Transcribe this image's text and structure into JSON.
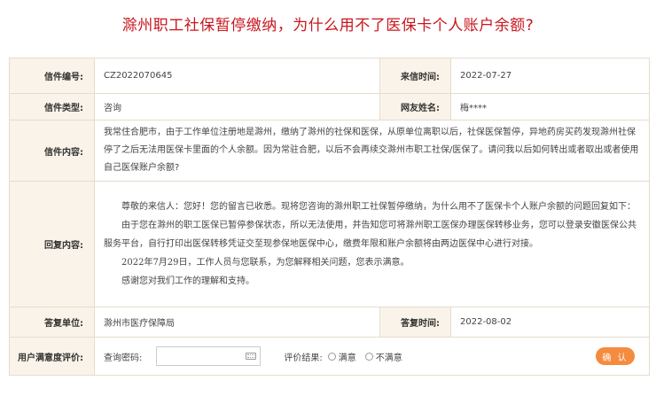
{
  "page_title": "滁州职工社保暂停缴纳，为什么用不了医保卡个人账户余额?",
  "letter": {
    "number_label": "信件编号:",
    "number": "CZ2022070645",
    "date_label": "来信时间:",
    "date": "2022-07-27",
    "type_label": "信件类型:",
    "type": "咨询",
    "user_label": "网友姓名:",
    "user": "梅****",
    "content_label": "信件内容:",
    "content": "我常住合肥市，由于工作单位注册地是滁州，缴纳了滁州的社保和医保，从原单位离职以后，社保医保暂停，异地药房买药发现滁州社保停了之后无法用医保卡里面的个人余额。因为常驻合肥，以后不会再续交滁州市职工社保/医保了。请问我以后如何转出或者取出或者使用自己医保账户余额?"
  },
  "reply": {
    "label": "回复内容:",
    "paragraphs": [
      "尊敬的来信人：您好！您的留言已收悉。现将您咨询的滁州职工社保暂停缴纳，为什么用不了医保卡个人账户余额的问题回复如下：",
      "由于您在滁州的职工医保已暂停参保状态，所以无法使用，并告知您可将滁州职工医保办理医保转移业务，您可以登录安徽医保公共服务平台，自行打印出医保转移凭证交至现参保地医保中心，缴费年限和账户余额将由两边医保中心进行对接。",
      "2022年7月29日，工作人员与您联系，为您解释相关问题，您表示满意。",
      "感谢您对我们工作的理解和支持。"
    ],
    "unit_label": "答复单位:",
    "unit": "滁州市医疗保障局",
    "reply_date_label": "答复时间:",
    "reply_date": "2022-08-02"
  },
  "evaluation": {
    "label": "用户满意度评价:",
    "password_label": "查询密码:",
    "password_value": "",
    "result_label": "评价结果:",
    "option_satisfied": "满意",
    "option_unsatisfied": "不满意",
    "confirm": "确 认"
  },
  "colors": {
    "title": "#c8161d",
    "label_bg": "#f9f3e9",
    "border": "#e6dccc",
    "button": "#f48b3f"
  }
}
